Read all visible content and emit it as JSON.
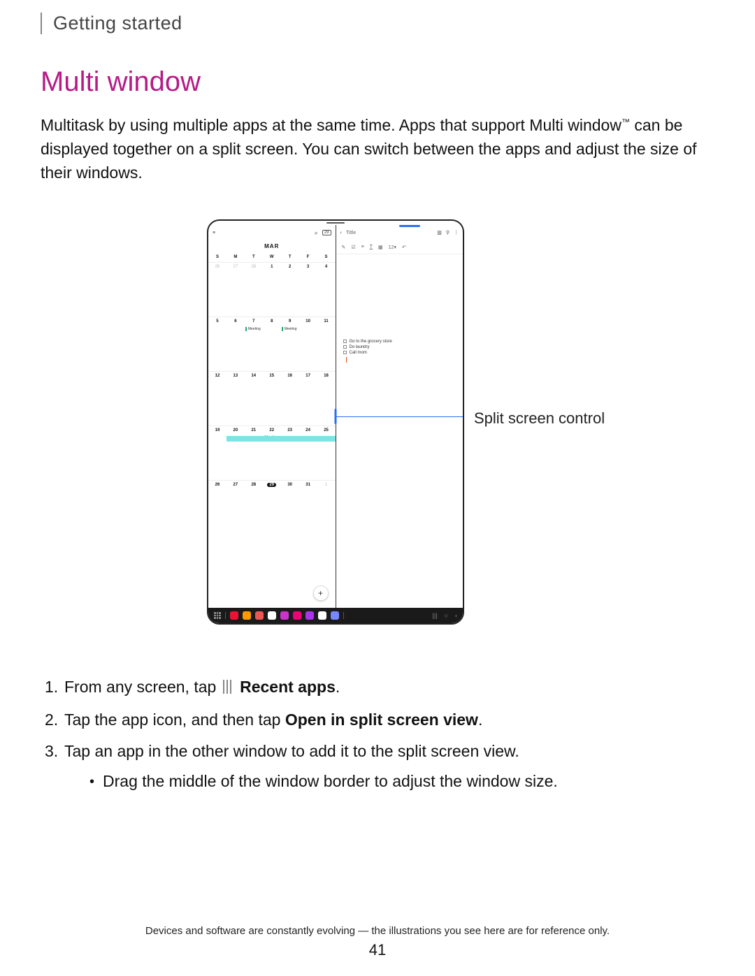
{
  "breadcrumb": "Getting started",
  "title": "Multi window",
  "intro_pre_tm": "Multitask by using multiple apps at the same time. Apps that support Multi window",
  "intro_tm": "™",
  "intro_post_tm": " can be displayed together on a split screen. You can switch between the apps and adjust the size of their windows.",
  "callout": "Split screen control",
  "figure": {
    "left_pane": {
      "month": "MAR",
      "day_headers": [
        "S",
        "M",
        "T",
        "W",
        "T",
        "F",
        "S"
      ],
      "weeks": [
        [
          {
            "n": "26",
            "dim": true
          },
          {
            "n": "27",
            "dim": true
          },
          {
            "n": "28",
            "dim": true
          },
          {
            "n": "1"
          },
          {
            "n": "2"
          },
          {
            "n": "3"
          },
          {
            "n": "4"
          }
        ],
        [
          {
            "n": "5"
          },
          {
            "n": "6"
          },
          {
            "n": "7",
            "evt": "Meeting"
          },
          {
            "n": "8"
          },
          {
            "n": "9",
            "evt": "Meeting"
          },
          {
            "n": "10"
          },
          {
            "n": "11"
          }
        ],
        [
          {
            "n": "12"
          },
          {
            "n": "13"
          },
          {
            "n": "14"
          },
          {
            "n": "15"
          },
          {
            "n": "16"
          },
          {
            "n": "17"
          },
          {
            "n": "18"
          }
        ],
        [
          {
            "n": "19"
          },
          {
            "n": "20",
            "vac": "start"
          },
          {
            "n": "21",
            "vac": "mid"
          },
          {
            "n": "22",
            "vac": "mid",
            "vactxt": "Vacation"
          },
          {
            "n": "23",
            "vac": "mid"
          },
          {
            "n": "24",
            "vac": "mid"
          },
          {
            "n": "25",
            "vac": "end"
          }
        ],
        [
          {
            "n": "26"
          },
          {
            "n": "27"
          },
          {
            "n": "28"
          },
          {
            "n": "29",
            "hl": true
          },
          {
            "n": "30"
          },
          {
            "n": "31"
          },
          {
            "n": "1",
            "dim": true
          }
        ]
      ],
      "today_badge": "29"
    },
    "right_pane": {
      "title": "Title",
      "toolbar2_zoom": "12",
      "checklist": [
        "Go to the grocery store",
        "Do laundry",
        "Call mom"
      ]
    },
    "dock_colors": [
      "#e13",
      "#f90",
      "#e55",
      "#fff",
      "#c3c",
      "#e07",
      "#a3e",
      "#fff",
      "#78f"
    ]
  },
  "steps": {
    "s1_pre": "From any screen, tap",
    "s1_bold": "Recent apps",
    "s1_post": ".",
    "s2_pre": "Tap the app icon, and then tap ",
    "s2_bold": "Open in split screen view",
    "s2_post": ".",
    "s3": "Tap an app in the other window to add it to the split screen view.",
    "s3_sub": "Drag the middle of the window border to adjust the window size."
  },
  "footnote": "Devices and software are constantly evolving — the illustrations you see here are for reference only.",
  "page": "41"
}
